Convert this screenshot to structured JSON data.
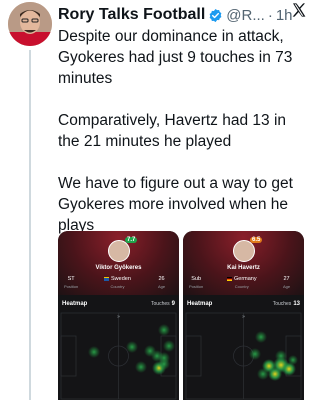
{
  "author": {
    "name": "Rory Talks Football",
    "handle": "@R...",
    "separator": "·",
    "time": "1h"
  },
  "tweet": {
    "paragraphs": [
      "Despite our dominance in attack, Gyokeres had just 9 touches in 73 minutes",
      "Comparatively, Havertz had 13 in the 21 minutes he played",
      "We have to figure out a way to get Gyokeres more involved when he plays"
    ]
  },
  "players": [
    {
      "name": "Viktor Gyökeres",
      "rating": "7.7",
      "rating_color": "#1fa34a",
      "position_value": "ST",
      "position_label": "Position",
      "country_value": "Sweden",
      "country_label": "Country",
      "age_value": "26",
      "age_label": "Age",
      "heatmap_label": "Heatmap",
      "touches_label": "Touches",
      "touches_value": "9"
    },
    {
      "name": "Kai Havertz",
      "rating": "6.5",
      "rating_color": "#e07b1a",
      "position_value": "Sub",
      "position_label": "Position",
      "country_value": "Germany",
      "country_label": "Country",
      "age_value": "27",
      "age_label": "Age",
      "heatmap_label": "Heatmap",
      "touches_label": "Touches",
      "touches_value": "13"
    }
  ],
  "colors": {
    "verified": "#1d9bf0",
    "pitch_line": "#2e3136",
    "heat_green": "#1f8a3a",
    "heat_yellow": "#d8c21a"
  }
}
